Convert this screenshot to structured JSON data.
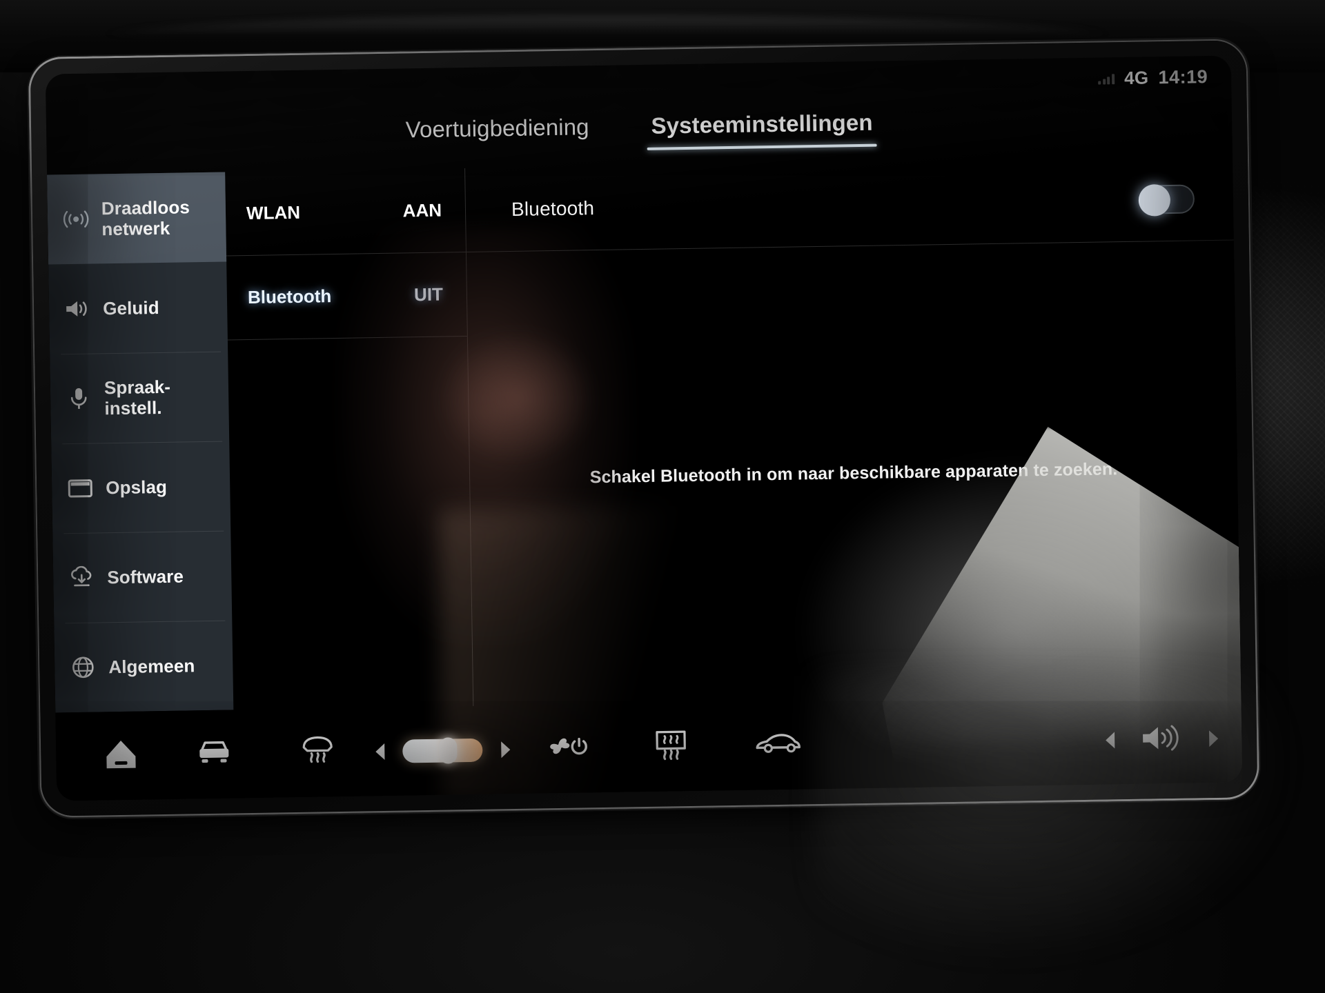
{
  "statusbar": {
    "signal_icon": "signal-bars-icon",
    "network": "4G",
    "time": "14:19"
  },
  "tabs": [
    {
      "label": "Voertuigbediening",
      "active": false
    },
    {
      "label": "Systeeminstellingen",
      "active": true
    }
  ],
  "sidebar": {
    "items": [
      {
        "label": "Draadloos netwerk",
        "icon": "wireless-network-icon",
        "active": true
      },
      {
        "label": "Geluid",
        "icon": "speaker-icon",
        "active": false
      },
      {
        "label": "Spraak-instell.",
        "icon": "microphone-icon",
        "active": false
      },
      {
        "label": "Opslag",
        "icon": "storage-icon",
        "active": false
      },
      {
        "label": "Software",
        "icon": "cloud-download-icon",
        "active": false
      },
      {
        "label": "Algemeen",
        "icon": "globe-icon",
        "active": false
      }
    ]
  },
  "network_list": [
    {
      "name": "WLAN",
      "state": "AAN",
      "selected": false
    },
    {
      "name": "Bluetooth",
      "state": "UIT",
      "selected": true
    }
  ],
  "detail": {
    "title": "Bluetooth",
    "toggle_state": "off",
    "empty_message": "Schakel Bluetooth in om naar beschikbare apparaten te zoeken."
  },
  "climate": {
    "home_icon": "home-icon",
    "car_front_icon": "car-front-icon",
    "front_defrost_icon": "front-defrost-icon",
    "temp_decrease_icon": "arrow-left-icon",
    "temp_slider_level": "60%",
    "temp_increase_icon": "arrow-right-icon",
    "fan_power_icon": "fan-power-icon",
    "rear_defrost_icon": "rear-defrost-icon",
    "car_side_icon": "car-side-icon",
    "volume_down_icon": "arrow-left-icon",
    "volume_icon": "speaker-volume-icon",
    "volume_up_icon": "arrow-right-icon"
  },
  "colors": {
    "screen_background": "#000000",
    "sidebar_background": "#272d33",
    "sidebar_active": "#4d5660",
    "accent_underline": "#dfeaf2",
    "selected_text": "#eaf4ff",
    "slider_warm": "#f6b982"
  }
}
